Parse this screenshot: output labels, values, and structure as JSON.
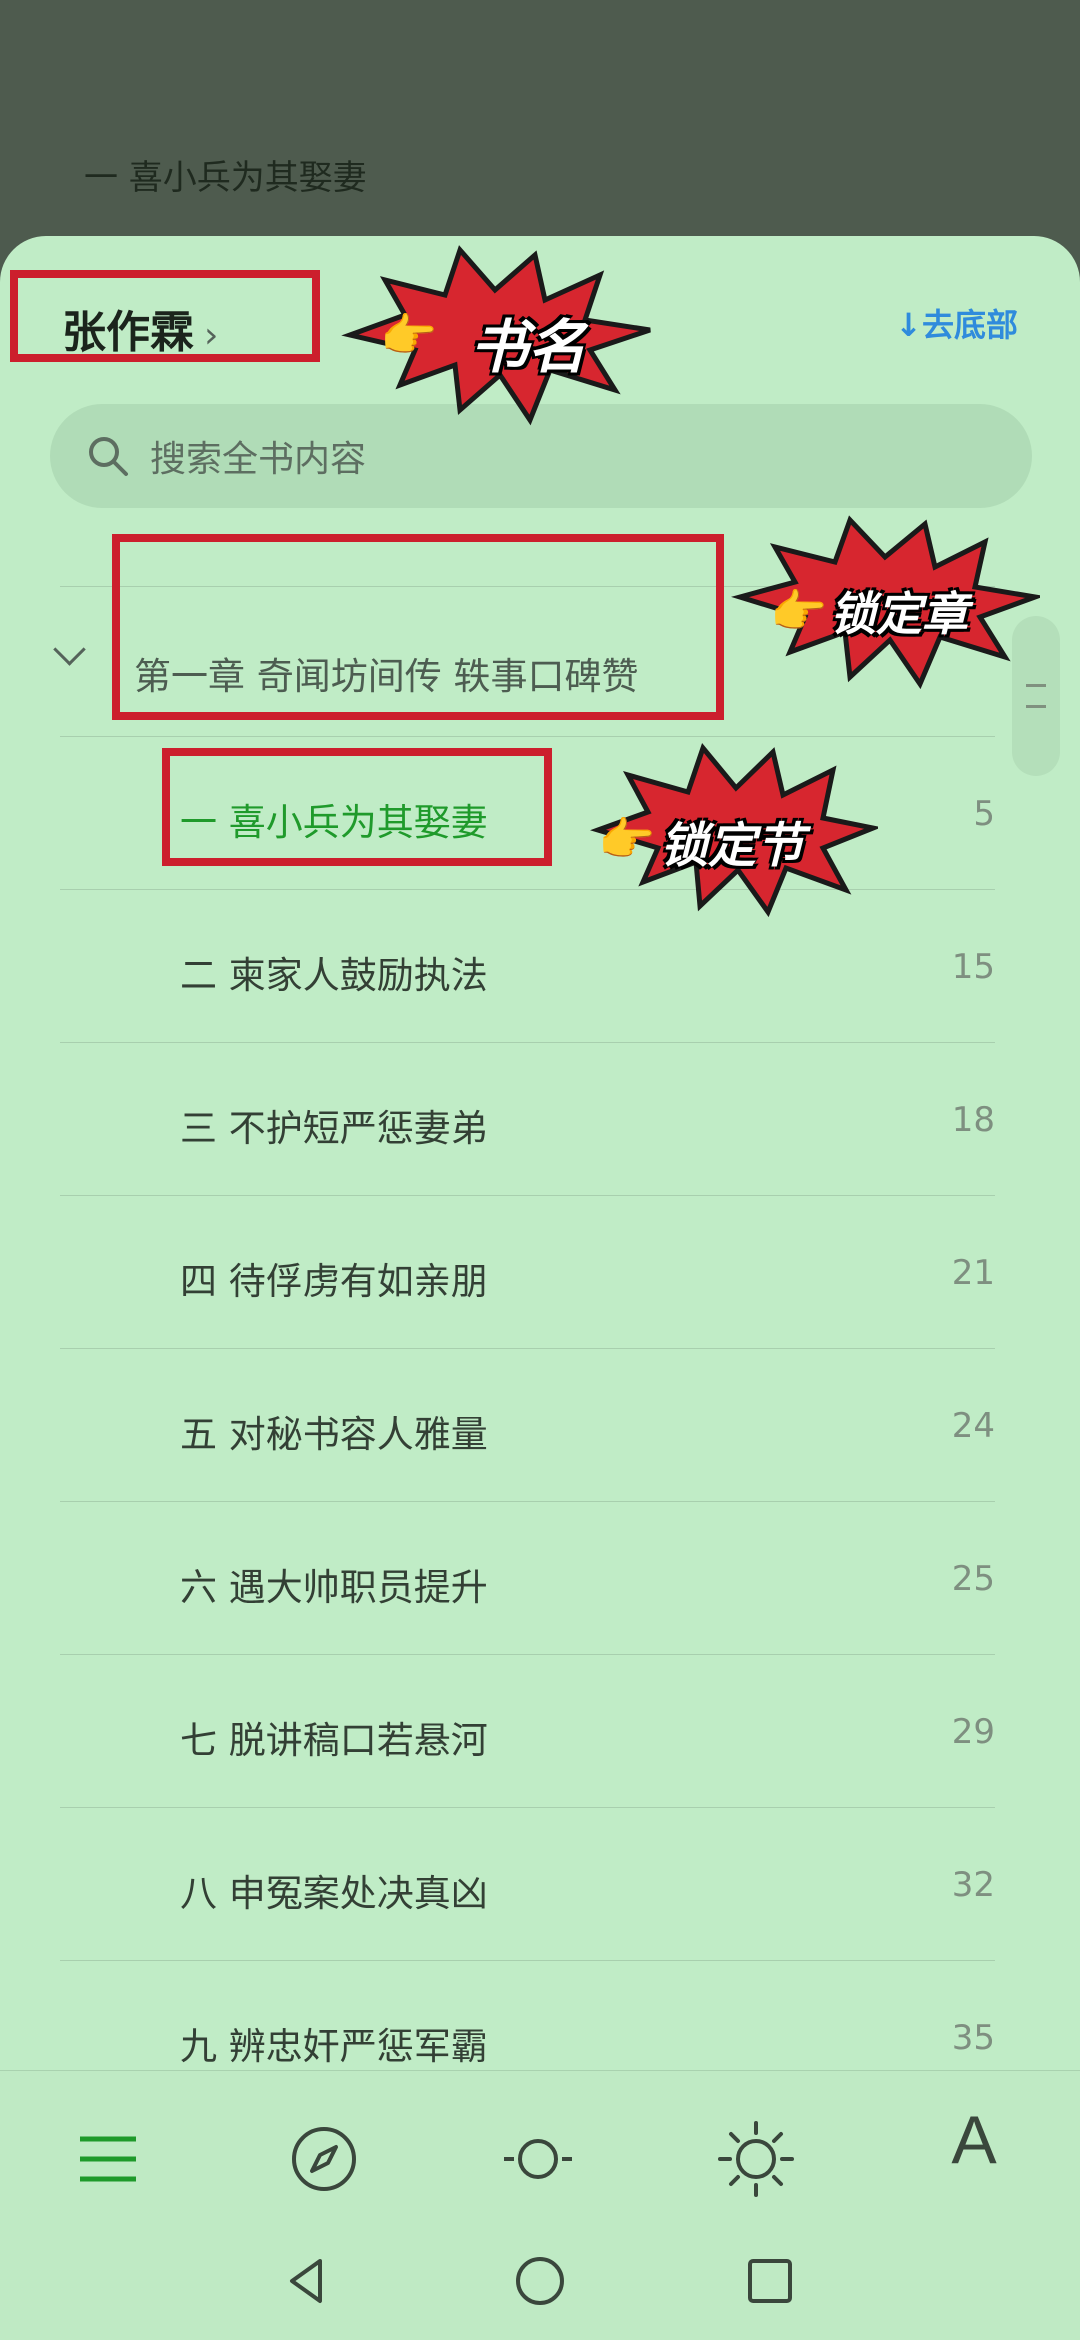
{
  "reader": {
    "current_chapter_top": "一 喜小兵为其娶妻"
  },
  "header": {
    "book_title": "张作霖",
    "title_chevron": "›",
    "go_bottom": "↓去底部"
  },
  "search": {
    "placeholder": "搜索全书内容"
  },
  "toc": {
    "chapter": "第一章 奇闻坊间传 轶事口碑赞",
    "sections": [
      {
        "title": "一 喜小兵为其娶妻",
        "page": "5",
        "active": true
      },
      {
        "title": "二 柬家人鼓励执法",
        "page": "15"
      },
      {
        "title": "三 不护短严惩妻弟",
        "page": "18"
      },
      {
        "title": "四 待俘虏有如亲朋",
        "page": "21"
      },
      {
        "title": "五 对秘书容人雅量",
        "page": "24"
      },
      {
        "title": "六 遇大帅职员提升",
        "page": "25"
      },
      {
        "title": "七 脱讲稿口若悬河",
        "page": "29"
      },
      {
        "title": "八 申冤案处决真凶",
        "page": "32"
      },
      {
        "title": "九 辨忠奸严惩军霸",
        "page": "35"
      }
    ]
  },
  "annotations": {
    "book_name": "书名",
    "lock_chapter": "锁定章",
    "lock_section": "锁定节"
  },
  "toolbar": {
    "font_label": "A"
  },
  "colors": {
    "sheet_bg": "#c0ecc6",
    "accent_green": "#1f9a2b",
    "link_blue": "#2f8bdc",
    "annotation_red": "#cc1f2d"
  },
  "icons": [
    "menu-icon",
    "compass-icon",
    "brightness-low-icon",
    "brightness-high-icon",
    "font-size-icon",
    "back-nav-icon",
    "home-nav-icon",
    "recents-nav-icon",
    "search-icon",
    "hand-pointer-icon"
  ]
}
